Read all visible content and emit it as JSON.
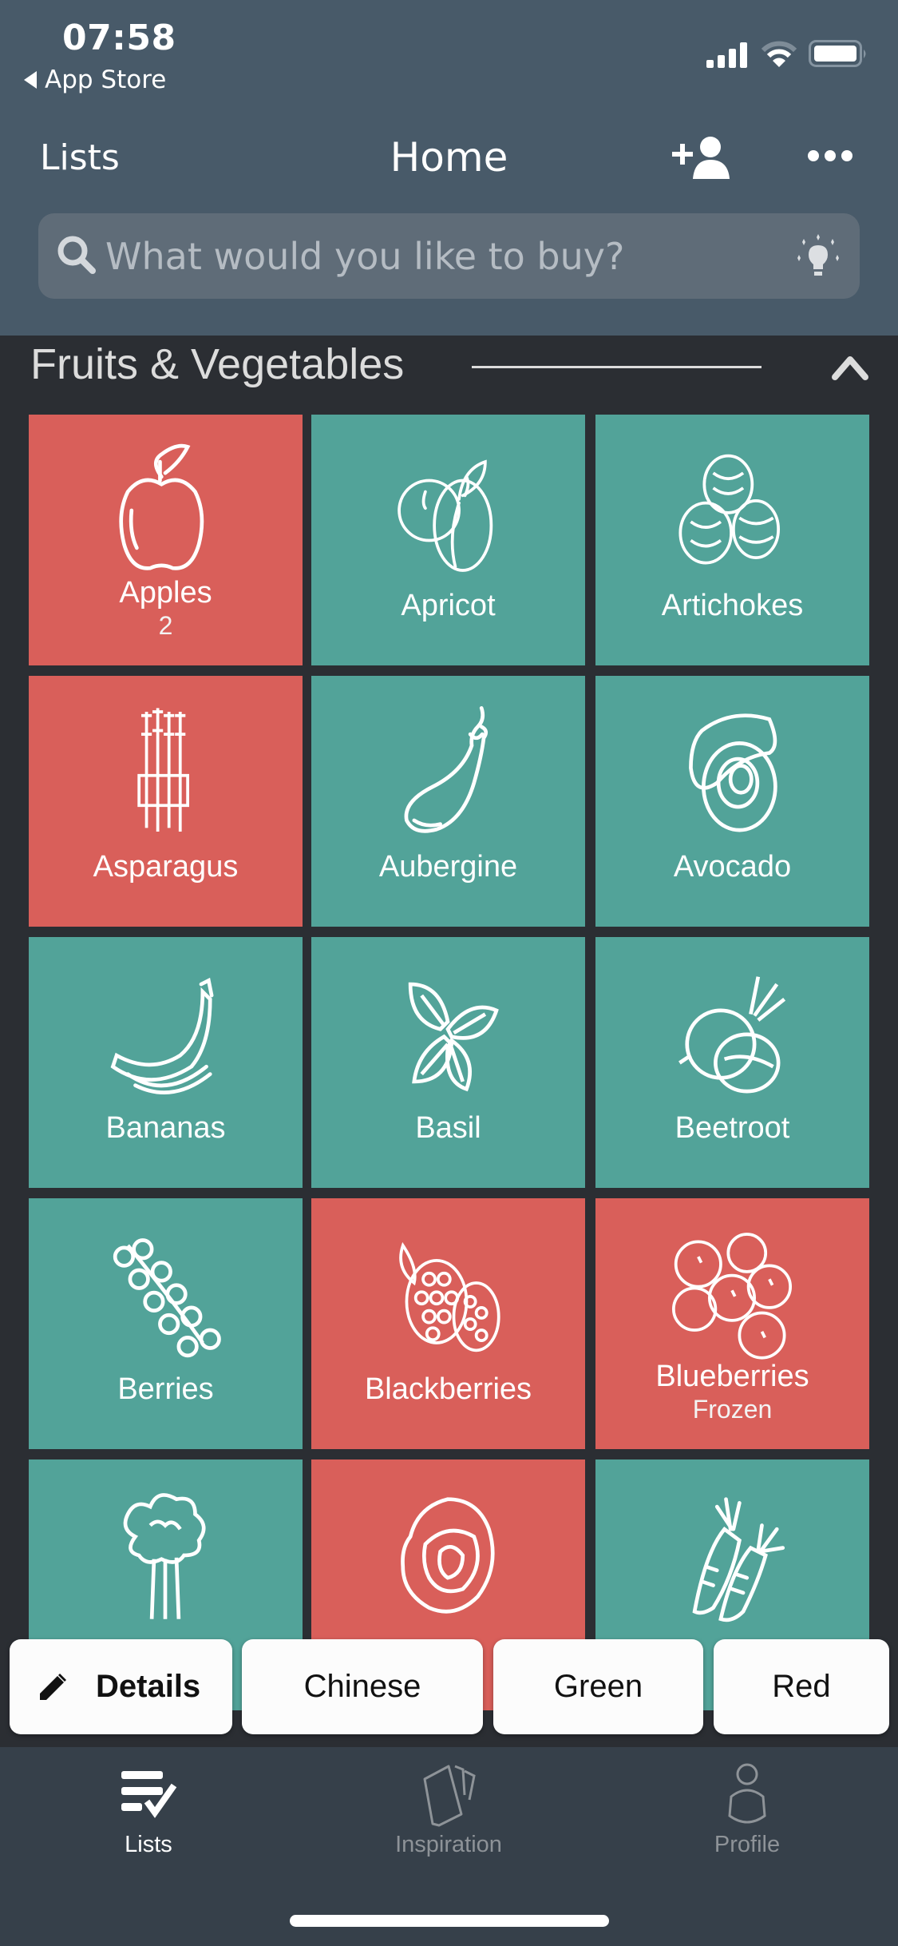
{
  "status_bar": {
    "time": "07:58",
    "back_label": "App Store",
    "icons": [
      "signal-icon",
      "wifi-icon",
      "battery-icon"
    ]
  },
  "nav": {
    "left_label": "Lists",
    "title": "Home",
    "add_user_icon": "add-user-icon",
    "more_icon": "more-icon"
  },
  "search": {
    "placeholder": "What would you like to buy?",
    "value": "",
    "left_icon": "search-icon",
    "right_icon": "lightbulb-icon"
  },
  "section": {
    "title": "Fruits & Vegetables",
    "toggle_icon": "chevron-up-icon"
  },
  "colors": {
    "selected": "#d95f5a",
    "unselected": "#52a399",
    "header": "#485a69",
    "background": "#2b2e33",
    "tabbar": "#36404a"
  },
  "tiles": [
    {
      "label": "Apples",
      "sub": "2",
      "selected": true,
      "icon": "apple-icon"
    },
    {
      "label": "Apricot",
      "sub": "",
      "selected": false,
      "icon": "apricot-icon"
    },
    {
      "label": "Artichokes",
      "sub": "",
      "selected": false,
      "icon": "artichoke-icon"
    },
    {
      "label": "Asparagus",
      "sub": "",
      "selected": true,
      "icon": "asparagus-icon"
    },
    {
      "label": "Aubergine",
      "sub": "",
      "selected": false,
      "icon": "aubergine-icon"
    },
    {
      "label": "Avocado",
      "sub": "",
      "selected": false,
      "icon": "avocado-icon"
    },
    {
      "label": "Bananas",
      "sub": "",
      "selected": false,
      "icon": "banana-icon"
    },
    {
      "label": "Basil",
      "sub": "",
      "selected": false,
      "icon": "basil-icon"
    },
    {
      "label": "Beetroot",
      "sub": "",
      "selected": false,
      "icon": "beetroot-icon"
    },
    {
      "label": "Berries",
      "sub": "",
      "selected": false,
      "icon": "berries-icon"
    },
    {
      "label": "Blackberries",
      "sub": "",
      "selected": true,
      "icon": "blackberries-icon"
    },
    {
      "label": "Blueberries",
      "sub": "Frozen",
      "selected": true,
      "icon": "blueberries-icon"
    },
    {
      "label": "",
      "sub": "",
      "selected": false,
      "icon": "broccoli-icon"
    },
    {
      "label": "",
      "sub": "",
      "selected": true,
      "icon": "cabbage-icon"
    },
    {
      "label": "",
      "sub": "",
      "selected": false,
      "icon": "carrot-icon"
    }
  ],
  "chips": {
    "details": "Details",
    "options": [
      "Chinese",
      "Green",
      "Red"
    ]
  },
  "tabbar": {
    "tabs": [
      {
        "label": "Lists",
        "icon": "lists-icon",
        "active": true
      },
      {
        "label": "Inspiration",
        "icon": "cards-icon",
        "active": false
      },
      {
        "label": "Profile",
        "icon": "profile-icon",
        "active": false
      }
    ]
  }
}
